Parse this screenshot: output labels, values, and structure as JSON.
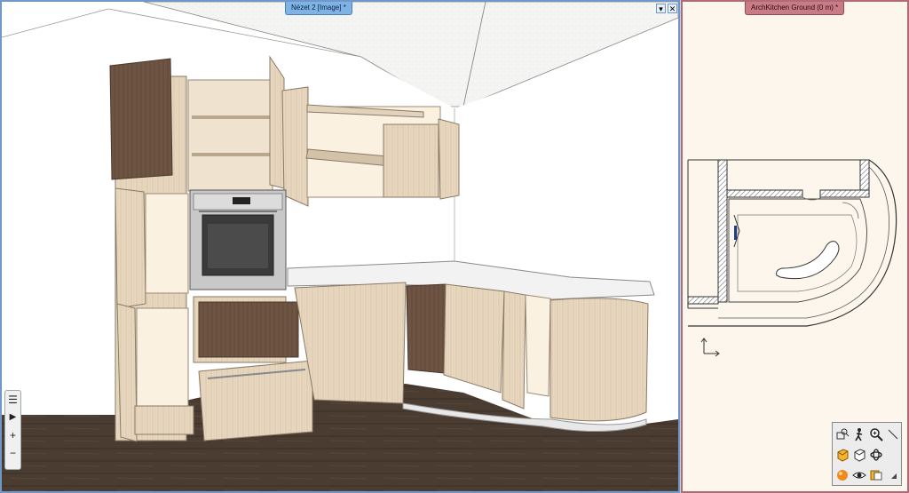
{
  "left_view": {
    "tab_title": "Nézet 2 [Image] *",
    "pin_glyph": "▾",
    "close_glyph": "✕",
    "toolbar": {
      "layers_icon": "☰",
      "play_icon": "▶",
      "zoom_in": "+",
      "zoom_out": "−"
    }
  },
  "right_view": {
    "tab_title": "ArchKitchen Ground (0 m) *",
    "toolbar_icons": [
      "zoom-window-icon",
      "walk-icon",
      "zoom-icon",
      "pan-icon",
      "solid-cube-icon",
      "wire-cube-icon",
      "orbit-icon",
      "render-sphere-icon",
      "eye-icon",
      "layers-icon"
    ]
  },
  "colors": {
    "left_border": "#6f98c8",
    "right_border": "#b06a78",
    "wood_light": "#e6d6bd",
    "wood_dark": "#6e5443",
    "floor": "#4a3b30",
    "plan_bg": "#fdf6ec"
  }
}
